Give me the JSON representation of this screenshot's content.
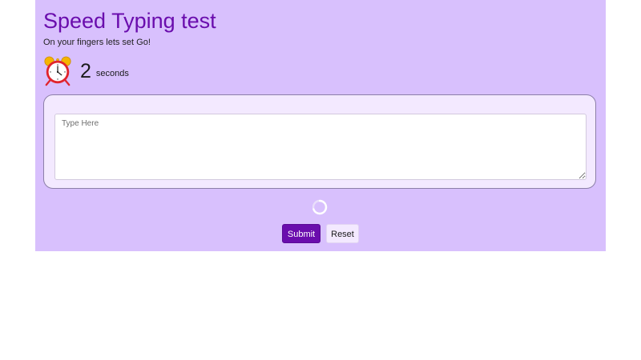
{
  "header": {
    "title": "Speed Typing test",
    "subtitle": "On your fingers lets set Go!"
  },
  "timer": {
    "icon": "alarm-clock-icon",
    "value": "2",
    "unit": "seconds"
  },
  "input": {
    "value": "",
    "placeholder": "Type Here"
  },
  "status": {
    "spinner_icon": "loading-spinner-icon"
  },
  "actions": {
    "submit_label": "Submit",
    "reset_label": "Reset"
  },
  "colors": {
    "page_background": "#d8c0fd",
    "card_background": "#f3e9ff",
    "accent": "#6a0dad",
    "clock_red": "#e0242d",
    "bell_gold": "#f5b400"
  }
}
